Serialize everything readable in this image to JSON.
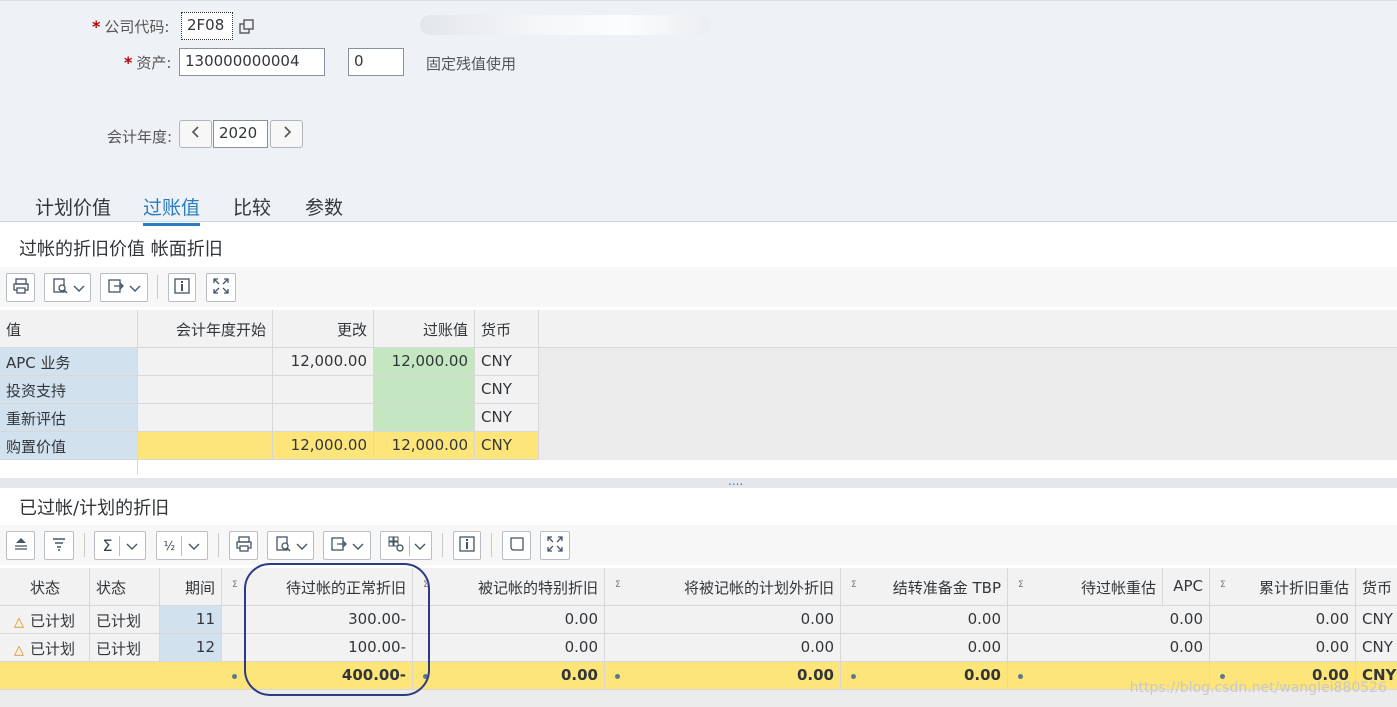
{
  "header": {
    "company_code_label": "公司代码:",
    "company_code_value": "2F08",
    "asset_label": "资产:",
    "asset_value": "130000000004",
    "asset_sub_value": "0",
    "asset_desc": "固定残值使用",
    "fiscal_year_label": "会计年度:",
    "fiscal_year_value": "2020",
    "required_mark": "*"
  },
  "tabs": [
    {
      "label": "计划价值"
    },
    {
      "label": "过账值"
    },
    {
      "label": "比较"
    },
    {
      "label": "参数"
    }
  ],
  "posted_values": {
    "title": "过帐的折旧价值 帐面折旧",
    "columns": [
      "值",
      "会计年度开始",
      "更改",
      "过账值",
      "货币"
    ],
    "rows": [
      {
        "value": "APC 业务",
        "fy_start": "",
        "change": "12,000.00",
        "posted": "12,000.00",
        "currency": "CNY"
      },
      {
        "value": "投资支持",
        "fy_start": "",
        "change": "",
        "posted": "",
        "currency": "CNY"
      },
      {
        "value": "重新评估",
        "fy_start": "",
        "change": "",
        "posted": "",
        "currency": "CNY"
      },
      {
        "value": "购置价值",
        "fy_start": "",
        "change": "12,000.00",
        "posted": "12,000.00",
        "currency": "CNY"
      }
    ]
  },
  "depreciation": {
    "title": "已过帐/计划的折旧",
    "columns": [
      "状态",
      "状态",
      "期间",
      "待过帐的正常折旧",
      "被记帐的特别折旧",
      "将被记帐的计划外折旧",
      "结转准备金 TBP",
      "待过帐重估",
      "APC",
      "累计折旧重估",
      "货币"
    ],
    "rows": [
      {
        "icon": "△",
        "status1": "已计划",
        "status2": "已计划",
        "period": "11",
        "normal": "300.00-",
        "special": "0.00",
        "unplanned": "0.00",
        "tbp": "0.00",
        "revaluation": "0.00",
        "accum": "0.00",
        "currency": "CNY"
      },
      {
        "icon": "△",
        "status1": "已计划",
        "status2": "已计划",
        "period": "12",
        "normal": "100.00-",
        "special": "0.00",
        "unplanned": "0.00",
        "tbp": "0.00",
        "revaluation": "0.00",
        "accum": "0.00",
        "currency": "CNY"
      }
    ],
    "totals": {
      "normal": "400.00-",
      "special": "0.00",
      "unplanned": "0.00",
      "tbp": "0.00",
      "accum": "0.00",
      "currency": "CNY"
    }
  },
  "splitter_dots": "....",
  "watermark": "https://blog.csdn.net/wanglei880526",
  "colors": {
    "accent": "#2b7cc0",
    "total_row": "#fde57a",
    "posted_cell": "#c4e6c0",
    "row_label": "#d2e1ee",
    "highlight_oval": "#2d3a85"
  }
}
